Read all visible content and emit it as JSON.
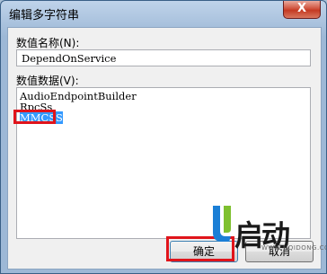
{
  "window": {
    "title": "编辑多字符串",
    "close_label": "X"
  },
  "form": {
    "value_name_label": "数值名称(N):",
    "value_name": "DependOnService",
    "value_data_label": "数值数据(V):",
    "value_data_lines": [
      "AudioEndpointBuilder",
      "RpcSs",
      "MMCSS"
    ]
  },
  "buttons": {
    "ok_label": "确定",
    "cancel_label": "取消"
  },
  "watermark": {
    "logo_text": "启动",
    "url": "WWW.UQIDONG.COM"
  },
  "colors": {
    "selection": "#3399ff",
    "annotation_box": "#e0141b",
    "close_button": "#c43a23"
  }
}
